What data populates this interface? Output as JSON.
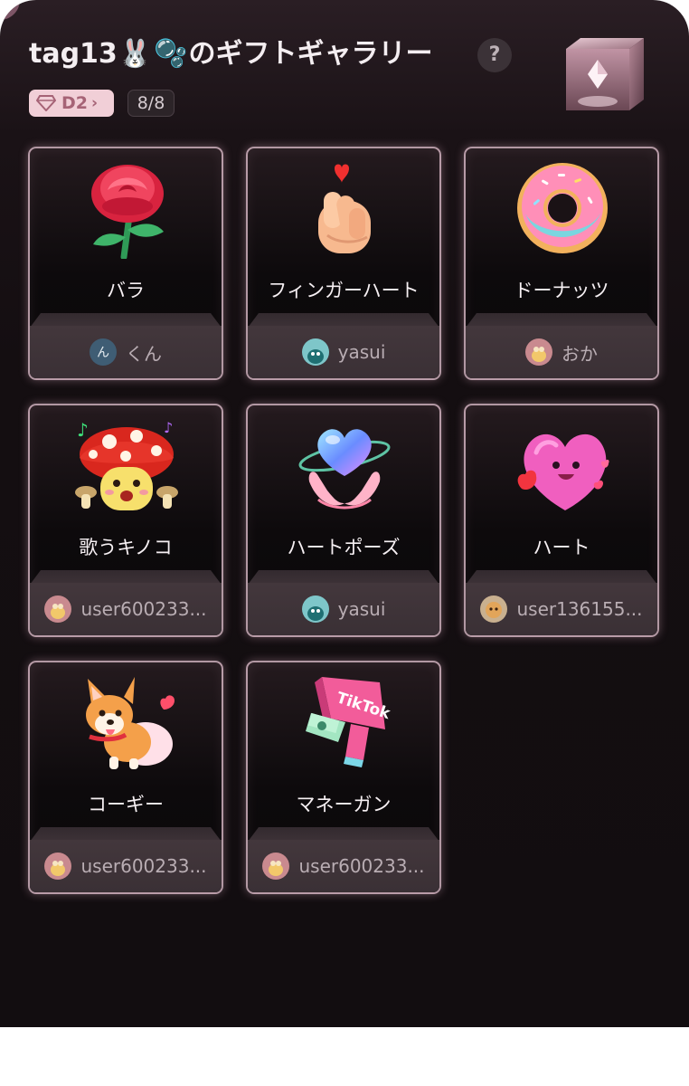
{
  "header": {
    "title_prefix": "tag13",
    "title_emoji_1": "🐰",
    "title_emoji_2": "🫧",
    "title_suffix": "のギフトギャラリー",
    "help_label": "?"
  },
  "badges": {
    "tier": "D2",
    "tier_chevron": "›",
    "count": "8/8"
  },
  "colors": {
    "background": "#140e11",
    "card_border": "#ebc8d7",
    "tier_badge": "#f1cfd7",
    "tier_text": "#a66376"
  },
  "gifts": [
    {
      "name": "バラ",
      "sender": "くん",
      "icon": "rose-icon",
      "avatar_char": "ん"
    },
    {
      "name": "フィンガーハート",
      "sender": "yasui",
      "icon": "finger-heart-icon",
      "avatar_char": ""
    },
    {
      "name": "ドーナッツ",
      "sender": "おか",
      "icon": "donut-icon",
      "avatar_char": ""
    },
    {
      "name": "歌うキノコ",
      "sender": "user600233...",
      "icon": "singing-mushroom-icon",
      "avatar_char": ""
    },
    {
      "name": "ハートポーズ",
      "sender": "yasui",
      "icon": "heart-pose-icon",
      "avatar_char": ""
    },
    {
      "name": "ハート",
      "sender": "user136155...",
      "icon": "heart-icon",
      "avatar_char": ""
    },
    {
      "name": "コーギー",
      "sender": "user600233...",
      "icon": "corgi-icon",
      "avatar_char": ""
    },
    {
      "name": "マネーガン",
      "sender": "user600233...",
      "icon": "money-gun-icon",
      "avatar_char": ""
    }
  ],
  "money_gun_text": "TikTok"
}
